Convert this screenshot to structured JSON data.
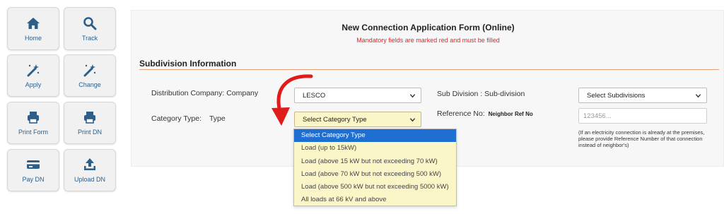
{
  "sidebar": {
    "items": [
      {
        "label": "Home",
        "icon": "home-icon"
      },
      {
        "label": "Track",
        "icon": "search-icon"
      },
      {
        "label": "Apply",
        "icon": "magic-wand-icon"
      },
      {
        "label": "Change",
        "icon": "magic-wand-icon"
      },
      {
        "label": "Print Form",
        "icon": "printer-icon"
      },
      {
        "label": "Print DN",
        "icon": "printer-icon"
      },
      {
        "label": "Pay DN",
        "icon": "credit-card-icon"
      },
      {
        "label": "Upload DN",
        "icon": "upload-icon"
      }
    ]
  },
  "form": {
    "title": "New Connection Application Form (Online)",
    "subtitle": "Mandatory fields are marked red and must be filled",
    "section_title": "Subdivision Information",
    "distribution_label": "Distribution Company: Company",
    "distribution_value": "LESCO",
    "category_label": "Category Type:",
    "category_label_sub": "Type",
    "category_value": "Select Category Type",
    "subdivision_label": "Sub Division : Sub-division",
    "subdivision_value": "Select Subdivisions",
    "reference_label": "Reference No:",
    "reference_label_sub": "Neighbor Ref No",
    "reference_placeholder": "123456...",
    "reference_hint": "(If an electricity connection is already at the premises, please provide Reference Number of that connection instead of neighbor's)"
  },
  "category_options": [
    "Select Category Type",
    "Load (up to 15kW)",
    "Load (above 15 kW but not exceeding 70 kW)",
    "Load (above 70 kW but not exceeding 500 kW)",
    "Load (above 500 kW but not exceeding 5000 kW)",
    "All loads at 66 kV and above"
  ],
  "colors": {
    "accent_blue": "#2d5f8a",
    "mandatory_red": "#e0262a",
    "selected_option": "#1e6fd1",
    "dropdown_bg": "#fbf6c7",
    "annotation_arrow": "#e01b1b"
  }
}
